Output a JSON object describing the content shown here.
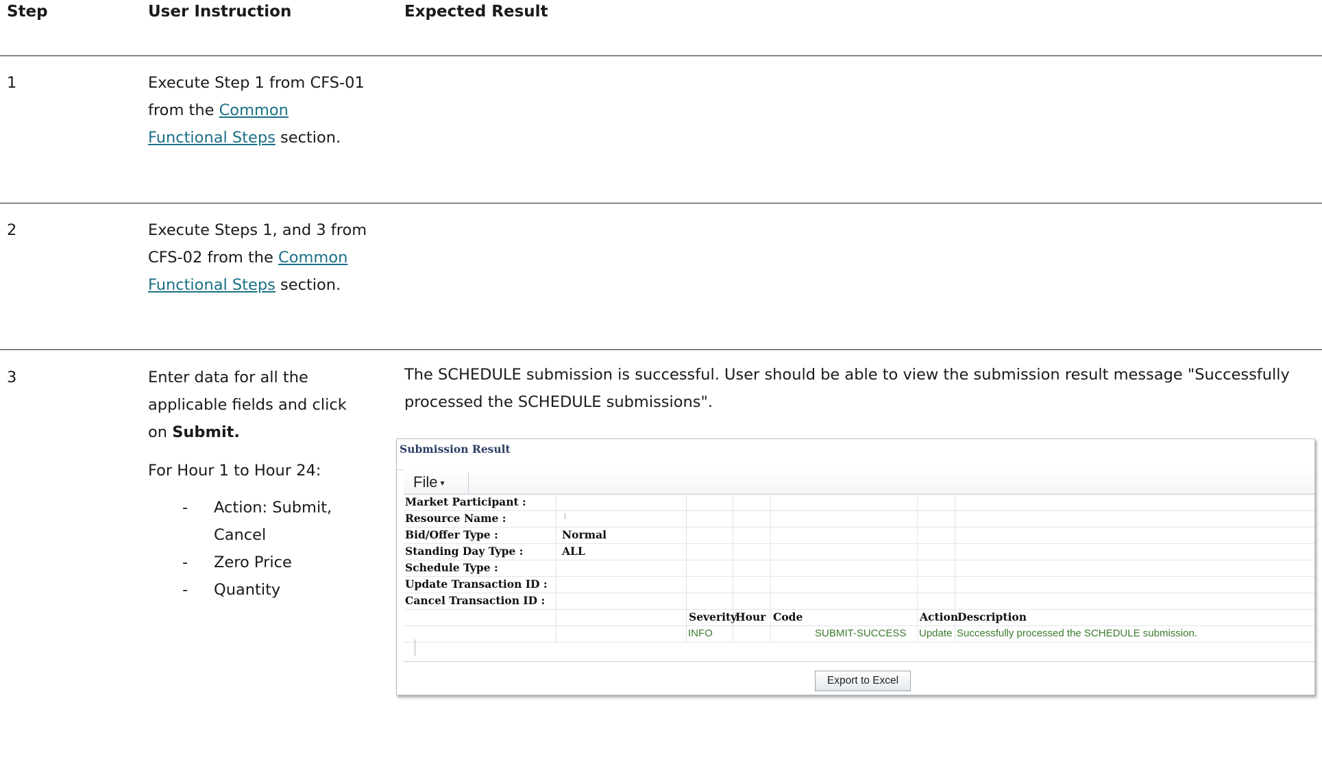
{
  "headers": {
    "step": "Step",
    "instruction": "User Instruction",
    "expected": "Expected Result"
  },
  "rows": [
    {
      "step": "1",
      "text_pre": "Execute Step 1 from CFS-01 from the ",
      "link": "Common Functional Steps",
      "text_post": " section."
    },
    {
      "step": "2",
      "text_pre": "Execute Steps 1, and 3 from CFS-02 from the ",
      "link": "Common Functional Steps",
      "text_post": " section."
    },
    {
      "step": "3",
      "text_pre": "Enter data for all the applicable fields and click on ",
      "bold": "Submit.",
      "hours_line": "For Hour 1 to Hour 24:",
      "bullets": [
        "Action: Submit, Cancel",
        "Zero Price",
        "Quantity"
      ],
      "dash": "-",
      "expected": "The SCHEDULE submission is successful. User should be able to view the submission result message \"Successfully processed the SCHEDULE submissions\"."
    }
  ],
  "screenshot": {
    "title": "Submission Result",
    "file_menu": "File",
    "fields": [
      {
        "label": "Market Participant :",
        "value": ""
      },
      {
        "label": "Resource Name :",
        "value": ""
      },
      {
        "label": "Bid/Offer Type :",
        "value": "Normal"
      },
      {
        "label": "Standing Day Type :",
        "value": "ALL"
      },
      {
        "label": "Schedule Type :",
        "value": ""
      },
      {
        "label": "Update Transaction ID :",
        "value": ""
      },
      {
        "label": "Cancel Transaction ID :",
        "value": ""
      }
    ],
    "result_columns": {
      "severity": "Severity",
      "hour": "Hour",
      "code": "Code",
      "action": "Action",
      "description": "Description"
    },
    "result_row": {
      "severity": "INFO",
      "hour": "",
      "code": "SUBMIT-SUCCESS",
      "action": "Update",
      "description": "Successfully processed the SCHEDULE submission."
    },
    "export_button": "Export to Excel"
  }
}
